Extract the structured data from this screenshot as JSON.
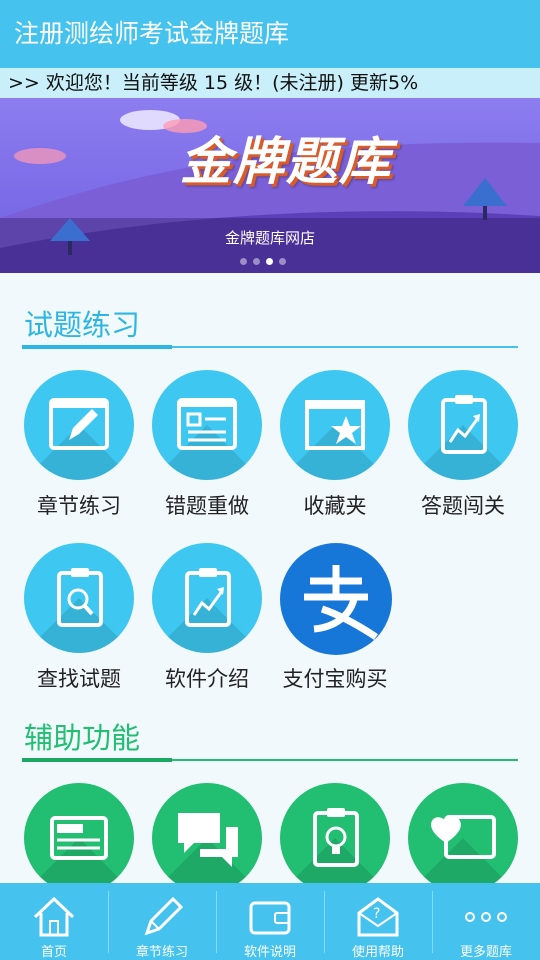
{
  "app": {
    "title": "注册测绘师考试金牌题库"
  },
  "notice": {
    "text": ">> 欢迎您！当前等级 15 级！(未注册) 更新5%"
  },
  "banner": {
    "title": "金牌题库",
    "caption": "金牌题库网店",
    "slide_count": 4,
    "active_slide": 3
  },
  "sections": {
    "practice": {
      "title": "试题练习",
      "items": [
        {
          "label": "章节练习",
          "icon": "edit-doc-icon"
        },
        {
          "label": "错题重做",
          "icon": "checklist-doc-icon"
        },
        {
          "label": "收藏夹",
          "icon": "star-folder-icon"
        },
        {
          "label": "答题闯关",
          "icon": "chart-clipboard-icon"
        },
        {
          "label": "查找试题",
          "icon": "search-clipboard-icon"
        },
        {
          "label": "软件介绍",
          "icon": "chart-clipboard-icon"
        },
        {
          "label": "支付宝购买",
          "icon": "alipay-icon"
        }
      ]
    },
    "tools": {
      "title": "辅助功能",
      "items": [
        {
          "icon": "news-icon"
        },
        {
          "icon": "chat-bubbles-icon"
        },
        {
          "icon": "lightbulb-clipboard-icon"
        },
        {
          "icon": "heart-card-icon"
        }
      ]
    }
  },
  "tabbar": [
    {
      "label": "首页",
      "icon": "home-icon"
    },
    {
      "label": "章节练习",
      "icon": "pencil-icon"
    },
    {
      "label": "软件说明",
      "icon": "wallet-icon"
    },
    {
      "label": "使用帮助",
      "icon": "help-mail-icon"
    },
    {
      "label": "更多题库",
      "icon": "more-dots-icon"
    }
  ],
  "colors": {
    "primary": "#45c3ee",
    "accent_blue": "#2db6e3",
    "green": "#22be72",
    "alipay": "#1677d8"
  }
}
